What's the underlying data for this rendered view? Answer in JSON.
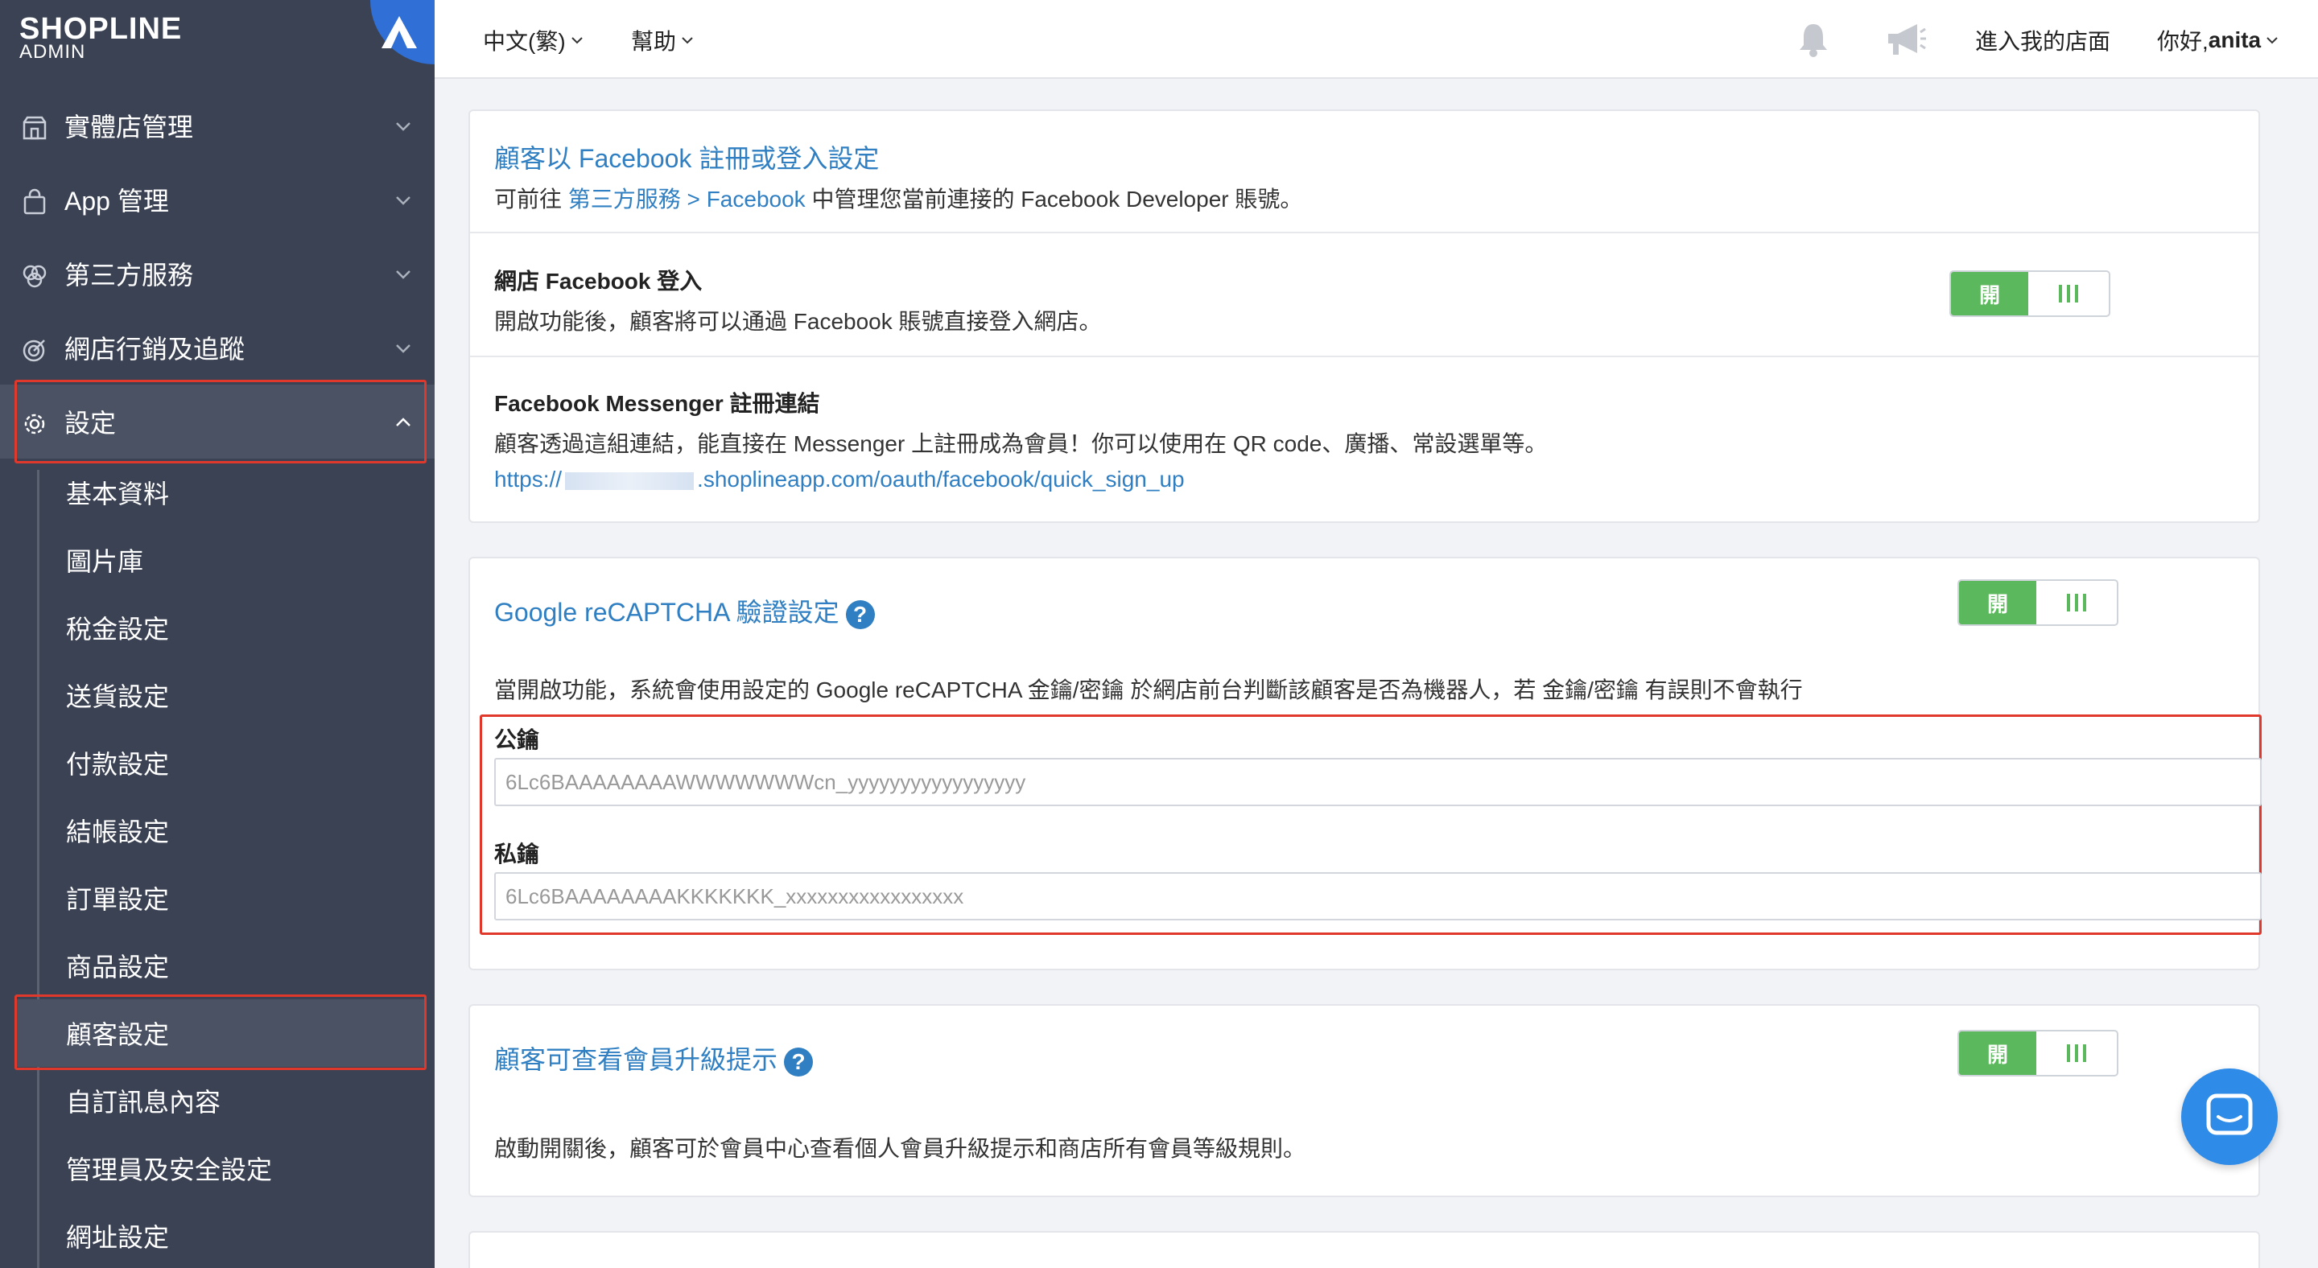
{
  "sidebar": {
    "brand": "SHOPLINE",
    "brand_sub": "ADMIN",
    "nav": [
      {
        "label": "實體店管理",
        "icon": "store-icon"
      },
      {
        "label": "App 管理",
        "icon": "shopping-bag-icon"
      },
      {
        "label": "第三方服務",
        "icon": "circles-icon"
      },
      {
        "label": "網店行銷及追蹤",
        "icon": "target-icon"
      },
      {
        "label": "設定",
        "icon": "gear-icon"
      }
    ],
    "sub_items": [
      "基本資料",
      "圖片庫",
      "稅金設定",
      "送貨設定",
      "付款設定",
      "結帳設定",
      "訂單設定",
      "商品設定",
      "顧客設定",
      "自訂訊息內容",
      "管理員及安全設定",
      "網址設定"
    ]
  },
  "topbar": {
    "language": "中文(繁)",
    "help": "幫助",
    "visit_store": "進入我的店面",
    "greeting": "你好, ",
    "user": "anita"
  },
  "facebook": {
    "title": "顧客以 Facebook 註冊或登入設定",
    "desc_prefix": "可前往 ",
    "desc_link": "第三方服務 > Facebook",
    "desc_suffix": " 中管理您當前連接的 Facebook Developer 賬號。",
    "login_title": "網店 Facebook 登入",
    "login_desc": "開啟功能後，顧客將可以通過 Facebook 賬號直接登入網店。",
    "messenger_title": "Facebook Messenger 註冊連結",
    "messenger_desc": "顧客透過這組連結，能直接在 Messenger 上註冊成為會員！你可以使用在 QR code、廣播、常設選單等。",
    "messenger_url_prefix": "https://",
    "messenger_url_suffix": ".shoplineapp.com/oauth/facebook/quick_sign_up"
  },
  "recaptcha": {
    "title": "Google reCAPTCHA 驗證設定",
    "desc": "當開啟功能，系統會使用設定的 Google reCAPTCHA 金鑰/密鑰 於網店前台判斷該顧客是否為機器人，若 金鑰/密鑰 有誤則不會執行",
    "public_key_label": "公鑰",
    "public_key_value": "6Lc6BAAAAAAAAWWWWWWWcn_yyyyyyyyyyyyyyyyy",
    "private_key_label": "私鑰",
    "private_key_value": "6Lc6BAAAAAAAAKKKKKKK_xxxxxxxxxxxxxxxxx"
  },
  "member_upgrade": {
    "title": "顧客可查看會員升級提示",
    "desc": "啟動開關後，顧客可於會員中心查看個人會員升級提示和商店所有會員等級規則。"
  },
  "toggle_on_label": "開"
}
